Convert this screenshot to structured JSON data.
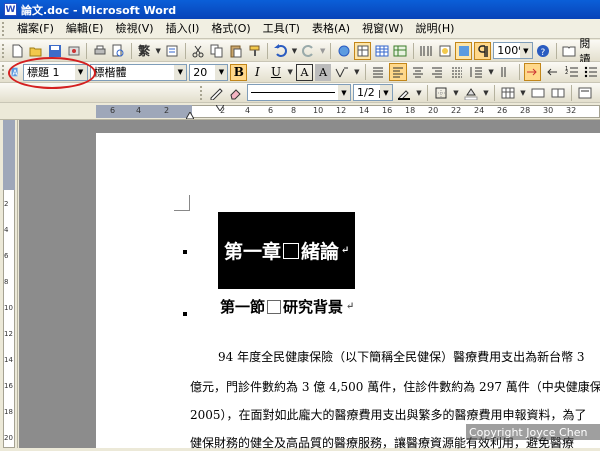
{
  "window": {
    "title": "論文.doc - Microsoft Word",
    "app_icon": "W"
  },
  "menu": [
    "檔案(F)",
    "編輯(E)",
    "檢視(V)",
    "插入(I)",
    "格式(O)",
    "工具(T)",
    "表格(A)",
    "視窗(W)",
    "說明(H)"
  ],
  "toolbar": {
    "zoom": "100%",
    "reading_label": "閱讀",
    "draw_glyph": "繁"
  },
  "format": {
    "style": "標題 1",
    "font": "標楷體",
    "size": "20",
    "bold": "B",
    "italic": "I",
    "underline": "U",
    "char_border": "A",
    "char_shading": "A"
  },
  "toolbar3": {
    "spacing": "1/2 p"
  },
  "ruler": {
    "horizontal_ticks": [
      "6",
      "4",
      "2",
      "2",
      "4",
      "6",
      "8",
      "10",
      "12",
      "14",
      "16",
      "18",
      "20",
      "22",
      "24",
      "26",
      "28",
      "30",
      "32"
    ],
    "vertical_ticks": [
      "2",
      "4",
      "6",
      "8",
      "10",
      "12",
      "14",
      "16",
      "18",
      "20"
    ]
  },
  "document": {
    "heading1": {
      "left": "第一章",
      "right": "緒論",
      "para_mark": "↵"
    },
    "heading2": {
      "left": "第一節",
      "right": "研究背景",
      "para_mark": "↵"
    },
    "body": [
      "94 年度全民健康保險（以下簡稱全民健保）醫療費用支出為新台幣 3",
      "億元，門診件數約為 3 億 4,500 萬件，住診件數約為 297 萬件（中央健康保",
      "2005），在面對如此龐大的醫療費用支出與繁多的醫療費用申報資料，為了",
      "健保財務的健全及高品質的醫療服務，讓醫療資源能有效利用，避免醫療"
    ]
  },
  "watermark": "Copyright Joyce Chen"
}
